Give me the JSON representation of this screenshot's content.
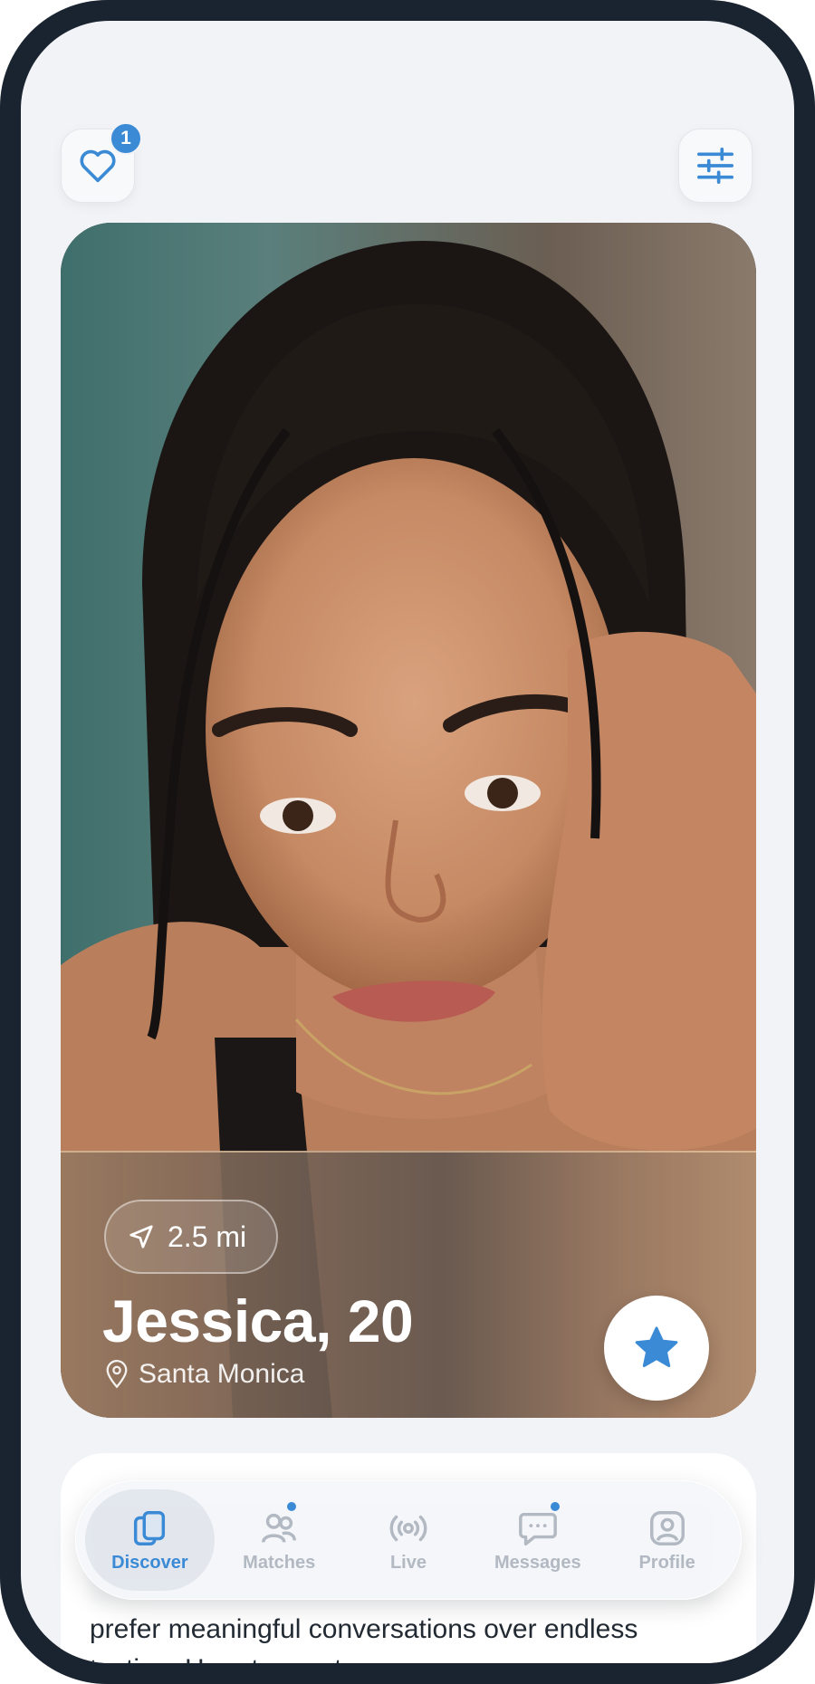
{
  "header": {
    "likes_count": "1"
  },
  "profile": {
    "distance": "2.5 mi",
    "name_age": "Jessica, 20",
    "location": "Santa Monica"
  },
  "bio": {
    "text": "prefer meaningful conversations over endless texting. Here to meet someone"
  },
  "tabs": [
    {
      "label": "Discover",
      "icon": "cards-icon",
      "active": true
    },
    {
      "label": "Matches",
      "icon": "people-icon",
      "active": false
    },
    {
      "label": "Live",
      "icon": "broadcast-icon",
      "active": false
    },
    {
      "label": "Messages",
      "icon": "chat-icon",
      "active": false
    },
    {
      "label": "Profile",
      "icon": "person-icon",
      "active": false
    }
  ],
  "colors": {
    "accent": "#3a8ad6",
    "frame": "#1a2330",
    "background": "#f1f3f6"
  }
}
